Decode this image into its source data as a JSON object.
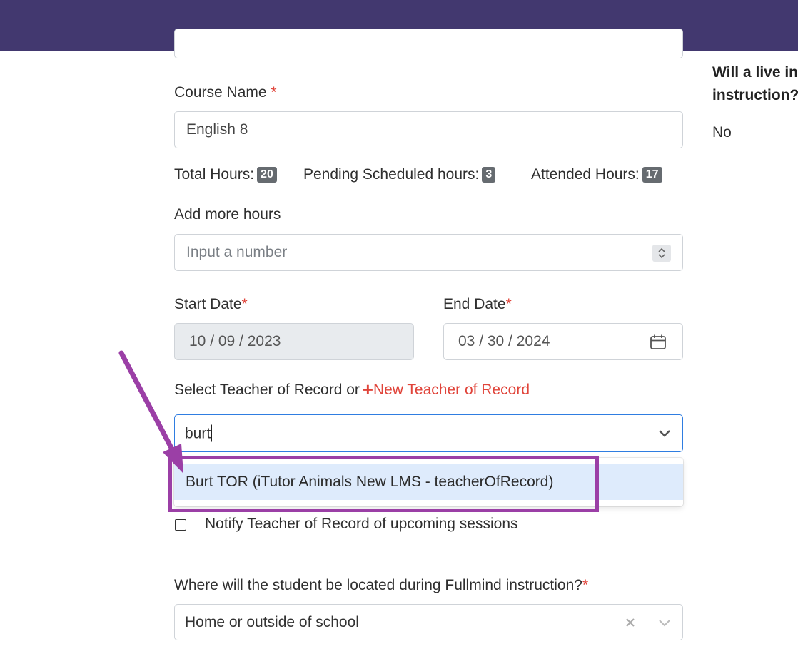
{
  "right_panel": {
    "question": "Will a live int instruction?",
    "question_line1": "Will a live int",
    "question_line2": "instruction?",
    "answer": "No"
  },
  "form": {
    "course_name": {
      "label": "Course Name",
      "required_mark": "*",
      "value": "English 8"
    },
    "hours": {
      "total_label": "Total Hours:",
      "total_value": "20",
      "pending_label": "Pending Scheduled hours:",
      "pending_value": "3",
      "attended_label": "Attended Hours:",
      "attended_value": "17"
    },
    "add_hours": {
      "label": "Add more hours",
      "placeholder": "Input a number"
    },
    "start_date": {
      "label": "Start Date",
      "required_mark": "*",
      "value": "10 / 09 / 2023"
    },
    "end_date": {
      "label": "End Date",
      "required_mark": "*",
      "value": "03 / 30 / 2024"
    },
    "teacher": {
      "label": "Select Teacher of Record or",
      "new_link": "New Teacher of Record",
      "plus": "+",
      "search_value": "burt",
      "option": "Burt TOR (iTutor Animals New LMS - teacherOfRecord)"
    },
    "notify": {
      "label": "Notify Teacher of Record of upcoming sessions",
      "checked": false
    },
    "location": {
      "label": "Where will the student be located during Fullmind instruction?",
      "required_mark": "*",
      "value": "Home or outside of school"
    }
  },
  "colors": {
    "topbar": "#42386f",
    "required": "#e0443a",
    "focus_border": "#2f7de1",
    "annotation": "#9b3fa6",
    "option_highlight": "#deebfc"
  }
}
